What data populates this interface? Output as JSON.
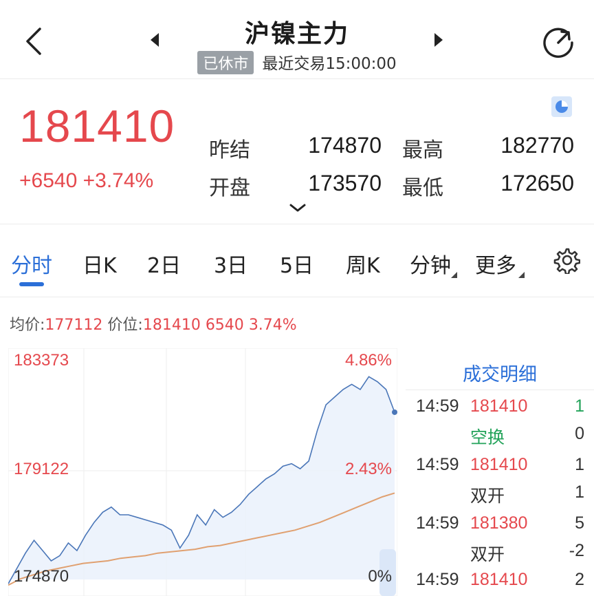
{
  "header": {
    "title": "沪镍主力",
    "status_badge": "已休市",
    "last_trade": "最近交易15:00:00"
  },
  "quote": {
    "price": "181410",
    "change": "+6540",
    "change_pct": "+3.74%",
    "prev_settle_label": "昨结",
    "prev_settle": "174870",
    "open_label": "开盘",
    "open": "173570",
    "high_label": "最高",
    "high": "182770",
    "low_label": "最低",
    "low": "172650"
  },
  "tabs": [
    "分时",
    "日K",
    "2日",
    "3日",
    "5日",
    "周K",
    "分钟",
    "更多"
  ],
  "info_line": {
    "avg_label": "均价:",
    "avg": "177112",
    "price_label": "价位:",
    "price": "181410",
    "change": "6540",
    "change_pct": "3.74%"
  },
  "chart_axis": {
    "top_price": "183373",
    "top_pct": "4.86%",
    "mid_price": "179122",
    "mid_pct": "2.43%",
    "base_price": "174870",
    "base_pct": "0%"
  },
  "chart_data": {
    "type": "line",
    "ylim": [
      174870,
      183373
    ],
    "series": [
      {
        "values": [
          174700,
          175300,
          175900,
          176400,
          176000,
          175600,
          175800,
          176300,
          176000,
          176600,
          177100,
          177500,
          177700,
          177400,
          177400,
          177300,
          177200,
          177100,
          177000,
          176800,
          176100,
          176600,
          177400,
          177000,
          177600,
          177300,
          177500,
          177800,
          178200,
          178500,
          178800,
          179000,
          179300,
          179400,
          179200,
          179500,
          180700,
          181700,
          182000,
          182300,
          182500,
          182300,
          182800,
          182600,
          182300,
          181410
        ]
      },
      {
        "values": [
          174650,
          174900,
          175050,
          175200,
          175300,
          175400,
          175500,
          175550,
          175600,
          175700,
          175750,
          175800,
          175900,
          175950,
          176000,
          176050,
          176150,
          176200,
          176300,
          176400,
          176500,
          176600,
          176700,
          176800,
          176950,
          177100,
          177300,
          177500,
          177700,
          177900,
          178100,
          178250
        ]
      }
    ],
    "colors": {
      "price": "#4a76b8",
      "avg": "#e0a070",
      "fill": "#e8f0fb"
    }
  },
  "trade_detail": {
    "title": "成交明细",
    "rows": [
      {
        "time": "14:59",
        "value": "181410",
        "volume": "1",
        "volume_green": true
      },
      {
        "time": "",
        "type": "空换",
        "type_green": true,
        "volume": "0"
      },
      {
        "time": "14:59",
        "value": "181410",
        "volume": "1"
      },
      {
        "time": "",
        "type": "双开",
        "volume": "1"
      },
      {
        "time": "14:59",
        "value": "181380",
        "volume": "5"
      },
      {
        "time": "",
        "type": "双开",
        "volume": "-2"
      },
      {
        "time": "14:59",
        "value": "181410",
        "volume": "2"
      }
    ]
  },
  "icons": {
    "back": "chevron-left-icon",
    "prev": "triangle-left-icon",
    "next": "triangle-right-icon",
    "refresh": "refresh-icon",
    "pie": "pie-chart-icon",
    "expand": "chevron-down-icon",
    "settings": "gear-icon"
  },
  "colors": {
    "up": "#e5484d",
    "down": "#23a35a",
    "accent": "#2b6fd8"
  }
}
